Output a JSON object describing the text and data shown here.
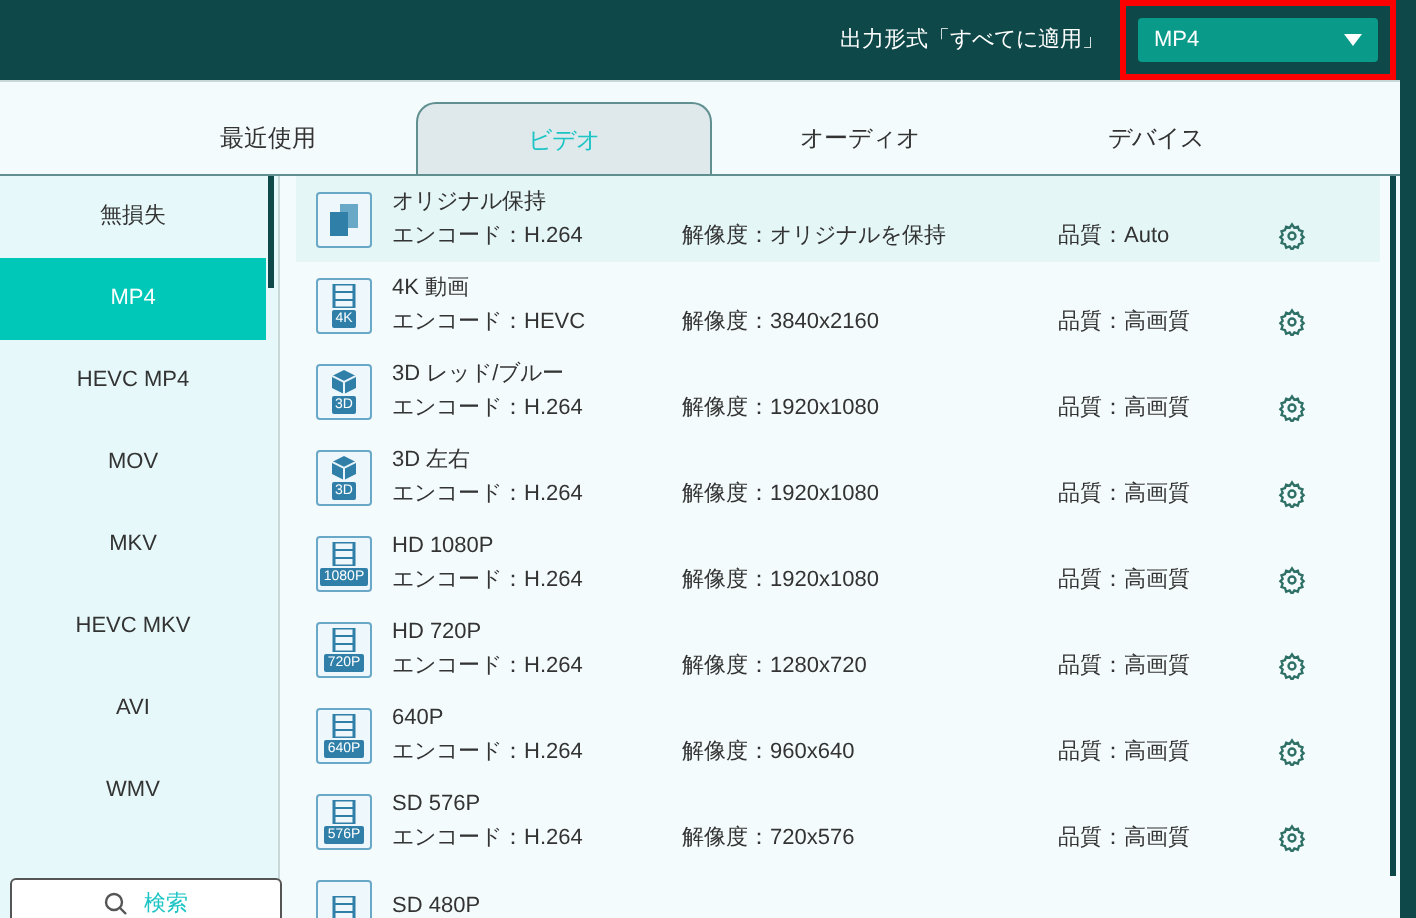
{
  "header": {
    "label": "出力形式「すべてに適用」",
    "format_select": {
      "value": "MP4",
      "highlighted": true
    }
  },
  "tabs": [
    {
      "label": "最近使用",
      "selected": false
    },
    {
      "label": "ビデオ",
      "selected": true
    },
    {
      "label": "オーディオ",
      "selected": false
    },
    {
      "label": "デバイス",
      "selected": false
    }
  ],
  "sidebar": {
    "items": [
      {
        "label": "無損失",
        "selected": false
      },
      {
        "label": "MP4",
        "selected": true
      },
      {
        "label": "HEVC MP4",
        "selected": false
      },
      {
        "label": "MOV",
        "selected": false
      },
      {
        "label": "MKV",
        "selected": false
      },
      {
        "label": "HEVC MKV",
        "selected": false
      },
      {
        "label": "AVI",
        "selected": false
      },
      {
        "label": "WMV",
        "selected": false
      }
    ],
    "search_button": "検索"
  },
  "presets": [
    {
      "kind": "copy",
      "name": "オリジナル保持",
      "encode": "エンコード：H.264",
      "resolution": "解像度：オリジナルを保持",
      "quality": "品質：Auto",
      "selected": true
    },
    {
      "kind": "film",
      "badge": "4K",
      "name": "4K 動画",
      "encode": "エンコード：HEVC",
      "resolution": "解像度：3840x2160",
      "quality": "品質：高画質",
      "selected": false
    },
    {
      "kind": "cube",
      "badge": "3D",
      "name": "3D レッド/ブルー",
      "encode": "エンコード：H.264",
      "resolution": "解像度：1920x1080",
      "quality": "品質：高画質",
      "selected": false
    },
    {
      "kind": "cube",
      "badge": "3D",
      "name": "3D 左右",
      "encode": "エンコード：H.264",
      "resolution": "解像度：1920x1080",
      "quality": "品質：高画質",
      "selected": false
    },
    {
      "kind": "film",
      "badge": "1080P",
      "name": "HD 1080P",
      "encode": "エンコード：H.264",
      "resolution": "解像度：1920x1080",
      "quality": "品質：高画質",
      "selected": false
    },
    {
      "kind": "film",
      "badge": "720P",
      "name": "HD 720P",
      "encode": "エンコード：H.264",
      "resolution": "解像度：1280x720",
      "quality": "品質：高画質",
      "selected": false
    },
    {
      "kind": "film",
      "badge": "640P",
      "name": "640P",
      "encode": "エンコード：H.264",
      "resolution": "解像度：960x640",
      "quality": "品質：高画質",
      "selected": false
    },
    {
      "kind": "film",
      "badge": "576P",
      "name": "SD 576P",
      "encode": "エンコード：H.264",
      "resolution": "解像度：720x576",
      "quality": "品質：高画質",
      "selected": false
    },
    {
      "kind": "film",
      "name": "SD 480P",
      "selected": false
    }
  ]
}
